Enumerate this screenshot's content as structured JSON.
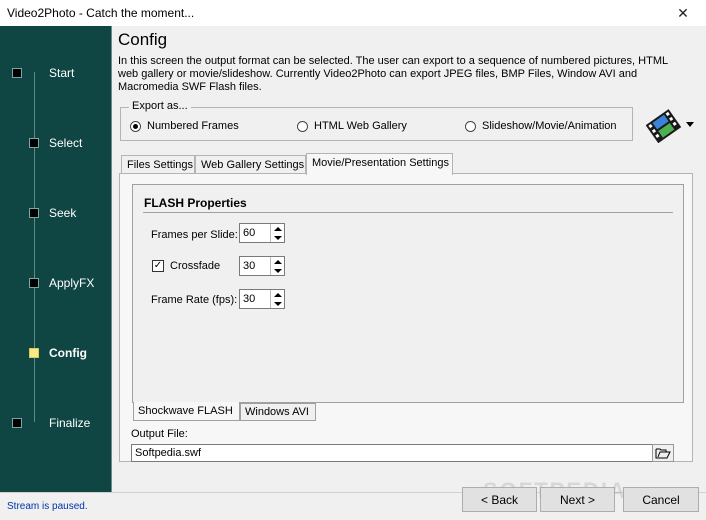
{
  "window": {
    "title": "Video2Photo - Catch the moment...",
    "close_glyph": "✕"
  },
  "sidebar": {
    "items": [
      {
        "label": "Start",
        "active": false
      },
      {
        "label": "Select",
        "active": false
      },
      {
        "label": "Seek",
        "active": false
      },
      {
        "label": "ApplyFX",
        "active": false
      },
      {
        "label": "Config",
        "active": true
      },
      {
        "label": "Finalize",
        "active": false
      }
    ]
  },
  "main": {
    "title": "Config",
    "description": "In this screen the output format can be selected. The user can export to a sequence of numbered pictures, HTML web gallery or movie/slideshow. Currently Video2Photo can export JPEG files, BMP Files, Window AVI and Macromedia SWF Flash files."
  },
  "export": {
    "legend": "Export as...",
    "options": [
      {
        "label": "Numbered Frames",
        "checked": true
      },
      {
        "label": "HTML Web Gallery",
        "checked": false
      },
      {
        "label": "Slideshow/Movie/Animation",
        "checked": false
      }
    ]
  },
  "tabs": [
    {
      "label": "Files Settings",
      "active": false
    },
    {
      "label": "Web Gallery Settings",
      "active": false
    },
    {
      "label": "Movie/Presentation Settings",
      "active": true
    }
  ],
  "flash": {
    "title": "FLASH Properties",
    "frames_per_slide_label": "Frames per Slide:",
    "frames_per_slide_value": "60",
    "crossfade_label": "Crossfade",
    "crossfade_checked": true,
    "crossfade_check_glyph": "✓",
    "crossfade_value": "30",
    "frame_rate_label": "Frame Rate (fps):",
    "frame_rate_value": "30"
  },
  "subtabs": [
    {
      "label": "Shockwave FLASH",
      "active": true
    },
    {
      "label": "Windows AVI",
      "active": false
    }
  ],
  "output": {
    "label": "Output File:",
    "value": "Softpedia.swf"
  },
  "status": {
    "text": "Stream is paused."
  },
  "buttons": {
    "back": "< Back",
    "next": "Next >",
    "cancel": "Cancel"
  },
  "watermark": "SOFTPEDIA",
  "colors": {
    "sidebar_bg": "#0f4542",
    "active_step": "#f8e98b",
    "status_text": "#0033aa"
  }
}
